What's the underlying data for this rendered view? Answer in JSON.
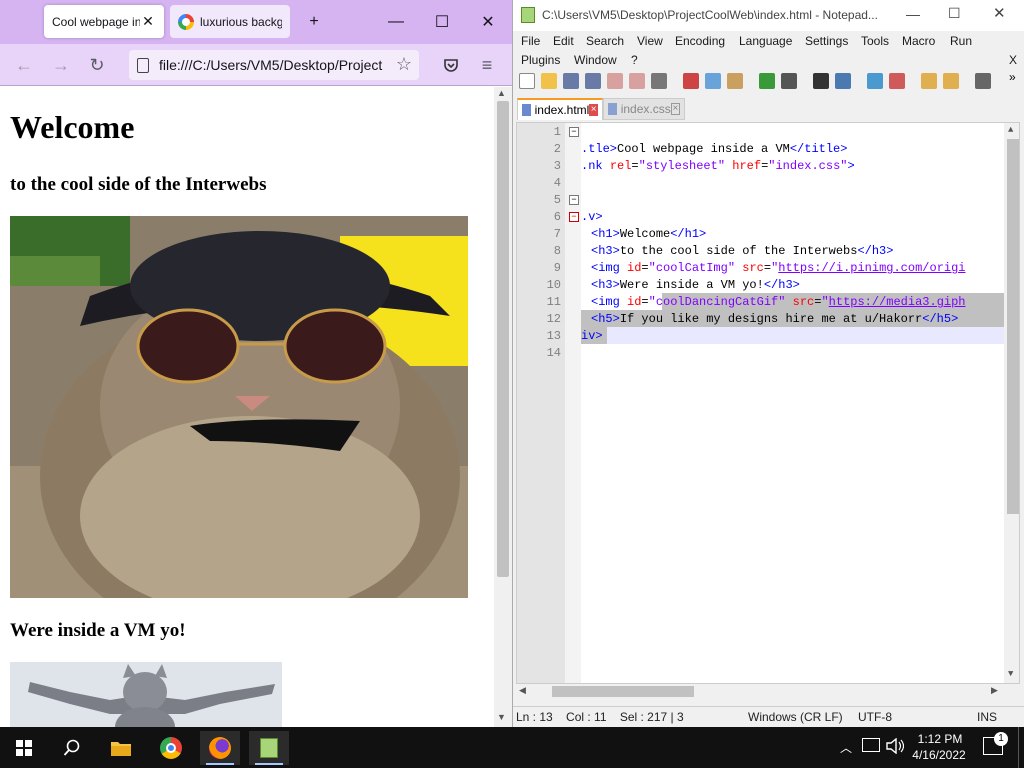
{
  "firefox": {
    "tabs": [
      {
        "label": "Cool webpage in",
        "active": true
      },
      {
        "label": "luxurious backg",
        "active": false
      }
    ],
    "new_tab_glyph": "+",
    "url": "file:///C:/Users/VM5/Desktop/Project",
    "page": {
      "h1": "Welcome",
      "h3_first": "to the cool side of the Interwebs",
      "h3_second": "Were inside a VM yo!"
    }
  },
  "notepad": {
    "title": "C:\\Users\\VM5\\Desktop\\ProjectCoolWeb\\index.html - Notepad...",
    "menu_row1": [
      "File",
      "Edit",
      "Search",
      "View",
      "Encoding",
      "Language",
      "Settings",
      "Tools",
      "Macro",
      "Run"
    ],
    "menu_row2": [
      "Plugins",
      "Window",
      "?"
    ],
    "menu_close": "X",
    "tabs": [
      {
        "label": "index.html",
        "active": true
      },
      {
        "label": "index.css",
        "active": false
      }
    ],
    "line_numbers": [
      "1",
      "2",
      "3",
      "4",
      "5",
      "6",
      "7",
      "8",
      "9",
      "10",
      "11",
      "12",
      "13",
      "14"
    ],
    "code": {
      "l2": {
        "a": ".tle>",
        "b": "Cool webpage inside a VM",
        "c": "</title>"
      },
      "l3": {
        "a": ".nk ",
        "b": "rel",
        "c": "=",
        "d": "\"stylesheet\"",
        "e": " href",
        "f": "=",
        "g": "\"index.css\"",
        "h": ">"
      },
      "l6": {
        "a": ".v>"
      },
      "l7": {
        "a": "<h1>",
        "b": "Welcome",
        "c": "</h1>"
      },
      "l8": {
        "a": "<h3>",
        "b": "to the cool side of the Interwebs",
        "c": "</h3>"
      },
      "l9": {
        "a": "<img ",
        "b": "id",
        "c": "=",
        "d": "\"coolCatImg\"",
        "e": " src",
        "f": "=",
        "g": "\"",
        "h": "https://i.pinimg.com/origi"
      },
      "l10": {
        "a": "<h3>",
        "b": "Were inside a VM yo!",
        "c": "</h3>"
      },
      "l11": {
        "a": "<img ",
        "b": "id",
        "c": "=",
        "d": "\"",
        "e": "coolDancingCatGif\"",
        "f": " src",
        "g": "=",
        "h": "\"",
        "i": "https://media3.giph"
      },
      "l12": {
        "a": "<h5>",
        "b": "If you like my designs hire me at u/Hakorr",
        "c": "</h5>"
      },
      "l13": {
        "a": "iv>"
      }
    },
    "status": {
      "position": "Ln : 13    Col : 11    Sel : 217 | 3",
      "eol": "Windows (CR LF)",
      "encoding": "UTF-8",
      "mode": "INS"
    }
  },
  "taskbar": {
    "time": "1:12 PM",
    "date": "4/16/2022",
    "notifications": "1"
  }
}
